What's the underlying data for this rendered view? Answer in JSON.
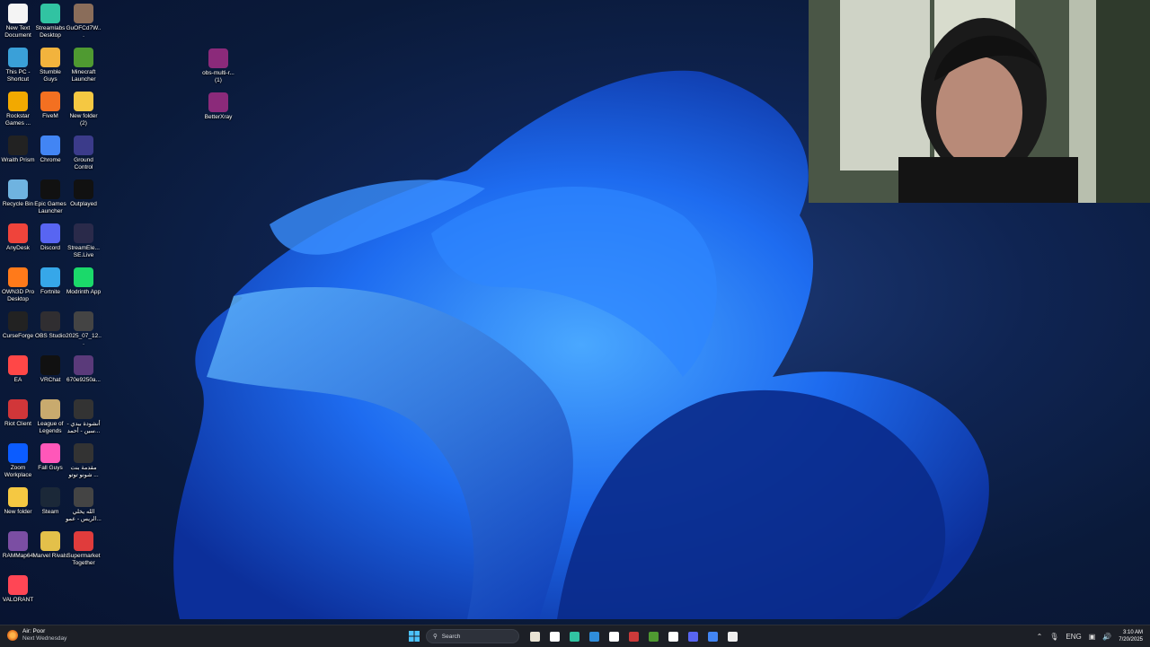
{
  "desktop": {
    "icons": [
      {
        "label": "New Text Document",
        "icon": "text-document-icon",
        "color": "#f4f4f4"
      },
      {
        "label": "Streamlabs Desktop",
        "icon": "streamlabs-icon",
        "color": "#31c3a2"
      },
      {
        "label": "GuOFCd7W...",
        "icon": "image-file-icon",
        "color": "#8a6d5a"
      },
      {
        "label": "This PC - Shortcut",
        "icon": "computer-icon",
        "color": "#3aa0d8"
      },
      {
        "label": "Stumble Guys",
        "icon": "stumble-guys-icon",
        "color": "#f2b33d"
      },
      {
        "label": "Minecraft Launcher",
        "icon": "minecraft-icon",
        "color": "#4f9a31"
      },
      {
        "label": "Rockstar Games ...",
        "icon": "rockstar-icon",
        "color": "#f2a900"
      },
      {
        "label": "FiveM",
        "icon": "fivem-icon",
        "color": "#f37021"
      },
      {
        "label": "New folder (2)",
        "icon": "folder-icon",
        "color": "#f5c842"
      },
      {
        "label": "Wraith Prism",
        "icon": "cooler-master-icon",
        "color": "#222"
      },
      {
        "label": "Chrome",
        "icon": "chrome-icon",
        "color": "#4285f4"
      },
      {
        "label": "Ground Control",
        "icon": "ground-control-icon",
        "color": "#3b3b8a"
      },
      {
        "label": "Recycle Bin",
        "icon": "recycle-bin-icon",
        "color": "#6fb3e0"
      },
      {
        "label": "Epic Games Launcher",
        "icon": "epic-games-icon",
        "color": "#111"
      },
      {
        "label": "Outplayed",
        "icon": "outplayed-icon",
        "color": "#111"
      },
      {
        "label": "AnyDesk",
        "icon": "anydesk-icon",
        "color": "#ef443b"
      },
      {
        "label": "Discord",
        "icon": "discord-icon",
        "color": "#5865f2"
      },
      {
        "label": "StreamEle... SE.Live",
        "icon": "streamelements-icon",
        "color": "#2a2a4a"
      },
      {
        "label": "OWN3D Pro Desktop",
        "icon": "own3d-icon",
        "color": "#ff7a1a"
      },
      {
        "label": "Fortnite",
        "icon": "fortnite-icon",
        "color": "#36a7e9"
      },
      {
        "label": "Modrinth App",
        "icon": "modrinth-icon",
        "color": "#1bd96a"
      },
      {
        "label": "CurseForge",
        "icon": "curseforge-icon",
        "color": "#222"
      },
      {
        "label": "OBS Studio",
        "icon": "obs-icon",
        "color": "#302e31"
      },
      {
        "label": "2025_07_12...",
        "icon": "video-file-icon",
        "color": "#444"
      },
      {
        "label": "EA",
        "icon": "ea-icon",
        "color": "#ff4747"
      },
      {
        "label": "VRChat",
        "icon": "vrchat-icon",
        "color": "#111"
      },
      {
        "label": "670e9250a...",
        "icon": "image-file-icon",
        "color": "#5a3a7a"
      },
      {
        "label": "Riot Client",
        "icon": "riot-icon",
        "color": "#d13639"
      },
      {
        "label": "League of Legends",
        "icon": "league-icon",
        "color": "#c8aa6e"
      },
      {
        "label": "أنشودة بيدي - سين - أحمد...",
        "icon": "video-file-icon",
        "color": "#333"
      },
      {
        "label": "Zoom Workplace",
        "icon": "zoom-icon",
        "color": "#0b5cff"
      },
      {
        "label": "Fall Guys",
        "icon": "fall-guys-icon",
        "color": "#ff57b9"
      },
      {
        "label": "مقدمة بنت شونو توتو ...",
        "icon": "video-file-icon",
        "color": "#333"
      },
      {
        "label": "New folder",
        "icon": "folder-icon",
        "color": "#f5c842"
      },
      {
        "label": "Steam",
        "icon": "steam-icon",
        "color": "#1b2838"
      },
      {
        "label": "الله يخلي الريس - عمو...",
        "icon": "video-file-icon",
        "color": "#444"
      },
      {
        "label": "RAMMap64",
        "icon": "rammap-icon",
        "color": "#7b4ea3"
      },
      {
        "label": "Marvel Rivals",
        "icon": "marvel-rivals-icon",
        "color": "#e3c04a"
      },
      {
        "label": "Supermarket Together",
        "icon": "supermarket-icon",
        "color": "#e03c3c"
      },
      {
        "label": "VALORANT",
        "icon": "valorant-icon",
        "color": "#ff4655"
      }
    ],
    "loose_icons": [
      {
        "label": "obs-multi-r... (1)",
        "icon": "winrar-archive-icon",
        "color": "#8b2a7a"
      },
      {
        "label": "BetterXray",
        "icon": "winrar-archive-icon",
        "color": "#8b2a7a"
      }
    ]
  },
  "taskbar": {
    "weather_title": "Air: Poor",
    "weather_sub": "Next Wednesday",
    "search_placeholder": "Search",
    "language": "ENG",
    "time": "3:10 AM",
    "date": "7/20/2025",
    "pinned": [
      {
        "icon": "calendar-icon",
        "color": "#e9e3d3"
      },
      {
        "icon": "file-icon",
        "color": "#ffffff"
      },
      {
        "icon": "streamlabs-icon",
        "color": "#31c3a2"
      },
      {
        "icon": "store-icon",
        "color": "#2f8ddb"
      },
      {
        "icon": "document-icon",
        "color": "#ffffff"
      },
      {
        "icon": "hp-icon",
        "color": "#cc3a3a"
      },
      {
        "icon": "minecraft-icon",
        "color": "#4f9a31"
      },
      {
        "icon": "xbox-icon",
        "color": "#ffffff"
      },
      {
        "icon": "discord-icon",
        "color": "#5865f2"
      },
      {
        "icon": "chrome-icon",
        "color": "#4285f4"
      },
      {
        "icon": "media-player-icon",
        "color": "#eeeeee"
      }
    ]
  }
}
